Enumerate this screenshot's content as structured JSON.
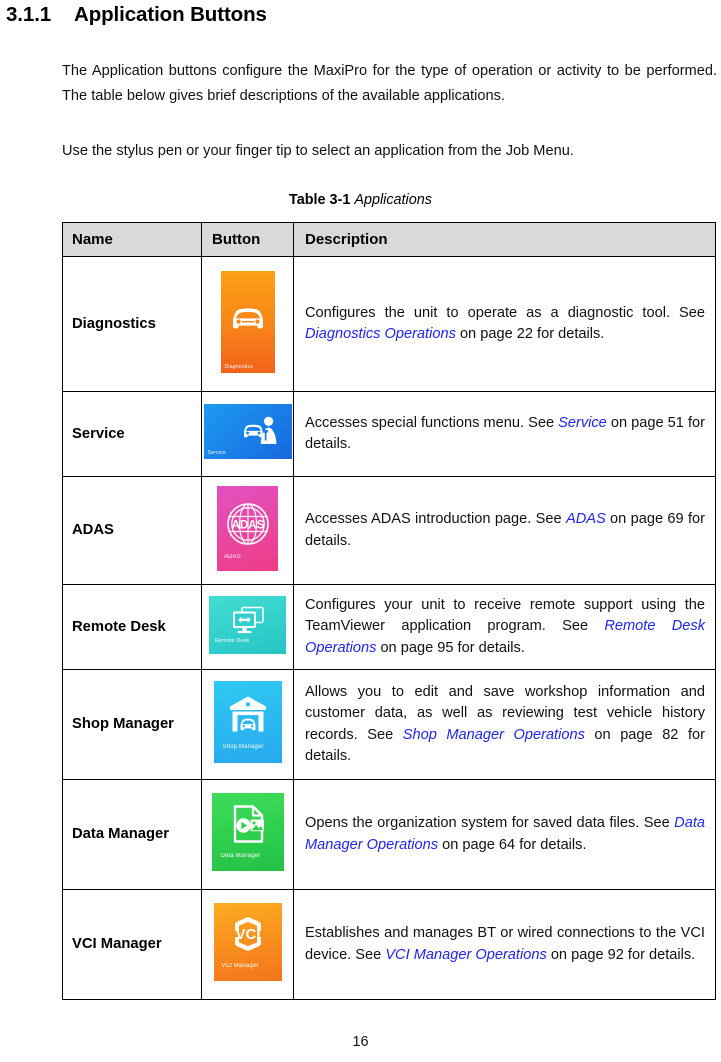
{
  "heading": {
    "number": "3.1.1",
    "title": "Application Buttons"
  },
  "paragraphs": {
    "p1": "The Application buttons configure the MaxiPro for the type of operation or activity to be performed. The table below gives brief descriptions of the available applications.",
    "p2": "Use the stylus pen or your finger tip to select an application from the Job Menu."
  },
  "table_caption": {
    "label": "Table 3-1",
    "title": "Applications"
  },
  "table": {
    "headers": {
      "name": "Name",
      "button": "Button",
      "description": "Description"
    },
    "rows": [
      {
        "name": "Diagnostics",
        "icon_name": "diagnostics-app-icon",
        "tile_label": "Diagnostics",
        "desc_pre": "Configures the unit to operate as a diagnostic tool. See ",
        "desc_link": "Diagnostics Operations",
        "desc_post": " on page 22 for details."
      },
      {
        "name": "Service",
        "icon_name": "service-app-icon",
        "tile_label": "Service",
        "desc_pre": "Accesses special functions menu. See ",
        "desc_link": "Service",
        "desc_post": " on page 51 for details."
      },
      {
        "name": "ADAS",
        "icon_name": "adas-app-icon",
        "tile_label": "ADAS",
        "desc_pre": "Accesses ADAS introduction page. See ",
        "desc_link": "ADAS",
        "desc_post": " on page 69 for details."
      },
      {
        "name": "Remote Desk",
        "icon_name": "remote-desk-app-icon",
        "tile_label": "Remote Desk",
        "desc_pre": "Configures your unit to receive remote support using the TeamViewer application program. See ",
        "desc_link": "Remote Desk Operations",
        "desc_post": " on page 95 for details."
      },
      {
        "name": "Shop Manager",
        "icon_name": "shop-manager-app-icon",
        "tile_label": "Shop Manager",
        "desc_pre": "Allows you to edit and save workshop information and customer data, as well as reviewing test vehicle history records. See ",
        "desc_link": "Shop Manager Operations",
        "desc_post": " on page 82 for details."
      },
      {
        "name": "Data Manager",
        "icon_name": "data-manager-app-icon",
        "tile_label": "Data Manager",
        "desc_pre": "Opens the organization system for saved data files. See ",
        "desc_link": "Data Manager Operations",
        "desc_post": " on page 64 for details."
      },
      {
        "name": "VCI Manager",
        "icon_name": "vci-manager-app-icon",
        "tile_label": "VCI Manager",
        "desc_pre": "Establishes and manages BT or wired connections to the VCI device. See ",
        "desc_link": "VCI Manager Operations",
        "desc_post": " on page 92 for details."
      }
    ]
  },
  "adas_glyph_text": "ADAS",
  "vci_glyph_text": "VCI",
  "page_number": "16",
  "colors": {
    "link": "#2323ee",
    "header_fill": "#d9d9d9",
    "border": "#000000",
    "diagnostics": "#f98a17",
    "service": "#1a7fe8",
    "adas": "#e8479f",
    "remote_desk": "#31cfcb",
    "shop_manager": "#2bb9f0",
    "data_manager": "#2fcf4e",
    "vci_manager": "#f8901d"
  }
}
